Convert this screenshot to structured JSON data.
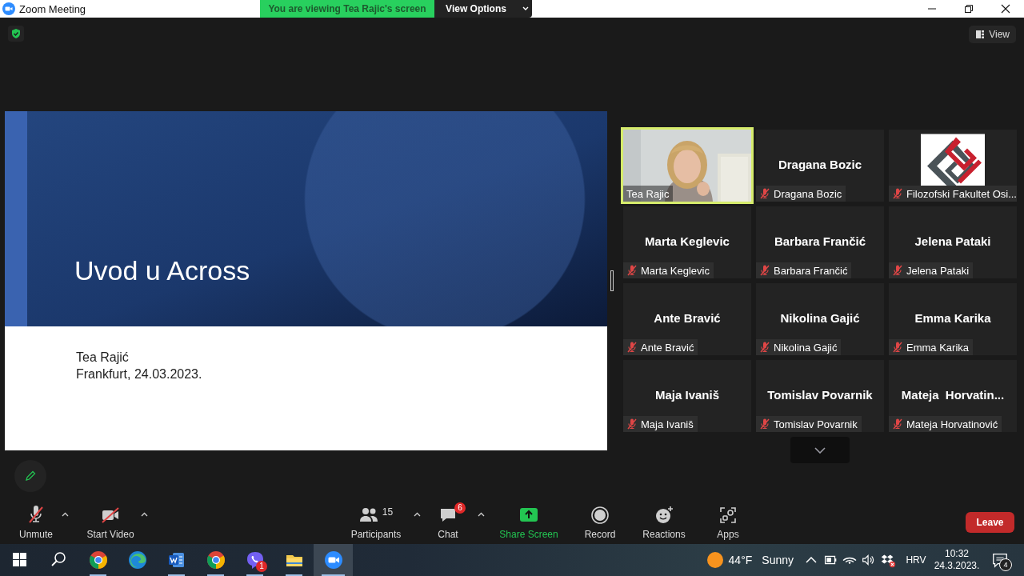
{
  "window": {
    "title": "Zoom Meeting"
  },
  "share_banner": {
    "text": "You are viewing Tea Rajic's screen",
    "options_label": "View Options"
  },
  "top_bar": {
    "view_label": "View"
  },
  "slide": {
    "title": "Uvod u Across",
    "lines": [
      "Tea Rajić",
      "Frankfurt, 24.03.2023."
    ]
  },
  "gallery": {
    "tiles": [
      {
        "kind": "video",
        "label": "Tea Rajic",
        "muted": false,
        "speaking": true
      },
      {
        "kind": "name",
        "display_name": "Dragana Bozic",
        "label": "Dragana Bozic",
        "muted": true,
        "speaking": false
      },
      {
        "kind": "avatar",
        "label": "Filozofski Fakultet Osi...",
        "muted": true,
        "speaking": false
      },
      {
        "kind": "name",
        "display_name": "Marta Keglevic",
        "label": "Marta Keglevic",
        "muted": true,
        "speaking": false
      },
      {
        "kind": "name",
        "display_name": "Barbara Frančić",
        "label": "Barbara Frančić",
        "muted": true,
        "speaking": false
      },
      {
        "kind": "name",
        "display_name": "Jelena Pataki",
        "label": "Jelena Pataki",
        "muted": true,
        "speaking": false
      },
      {
        "kind": "name",
        "display_name": "Ante Bravić",
        "label": "Ante Bravić",
        "muted": true,
        "speaking": false
      },
      {
        "kind": "name",
        "display_name": "Nikolina Gajić",
        "label": "Nikolina Gajić",
        "muted": true,
        "speaking": false
      },
      {
        "kind": "name",
        "display_name": "Emma Karika",
        "label": "Emma Karika",
        "muted": true,
        "speaking": false
      },
      {
        "kind": "name",
        "display_name": "Maja Ivaniš",
        "label": "Maja Ivaniš",
        "muted": true,
        "speaking": false
      },
      {
        "kind": "name",
        "display_name": "Tomislav Povarnik",
        "label": "Tomislav Povarnik",
        "muted": true,
        "speaking": false
      },
      {
        "kind": "name",
        "display_name": "Mateja  Horvatin...",
        "label": "Mateja Horvatinović",
        "muted": true,
        "speaking": false
      }
    ]
  },
  "toolbar": {
    "left": [
      {
        "kind": "mic",
        "label": "Unmute",
        "off": true
      },
      {
        "kind": "video",
        "label": "Start Video",
        "off": true
      }
    ],
    "center": [
      {
        "kind": "participants",
        "label": "Participants",
        "count": "15"
      },
      {
        "kind": "chat",
        "label": "Chat",
        "badge": "6"
      },
      {
        "kind": "share",
        "label": "Share Screen"
      },
      {
        "kind": "record",
        "label": "Record"
      },
      {
        "kind": "reactions",
        "label": "Reactions"
      },
      {
        "kind": "apps",
        "label": "Apps"
      }
    ],
    "leave_label": "Leave"
  },
  "taskbar": {
    "apps": [
      {
        "kind": "start",
        "running": false,
        "selected": false
      },
      {
        "kind": "search",
        "running": false,
        "selected": false
      },
      {
        "kind": "chrome",
        "running": true,
        "selected": false
      },
      {
        "kind": "edge",
        "running": false,
        "selected": false
      },
      {
        "kind": "word",
        "running": true,
        "selected": false
      },
      {
        "kind": "chrome",
        "running": true,
        "selected": false
      },
      {
        "kind": "viber",
        "running": true,
        "selected": false,
        "badge": "1"
      },
      {
        "kind": "explorer",
        "running": true,
        "selected": false
      },
      {
        "kind": "zoom",
        "running": true,
        "selected": true
      }
    ],
    "weather": {
      "temperature": "44°F",
      "condition": "Sunny"
    },
    "language": "HRV",
    "time": "10:32",
    "date": "24.3.2023.",
    "notifications": "4"
  }
}
